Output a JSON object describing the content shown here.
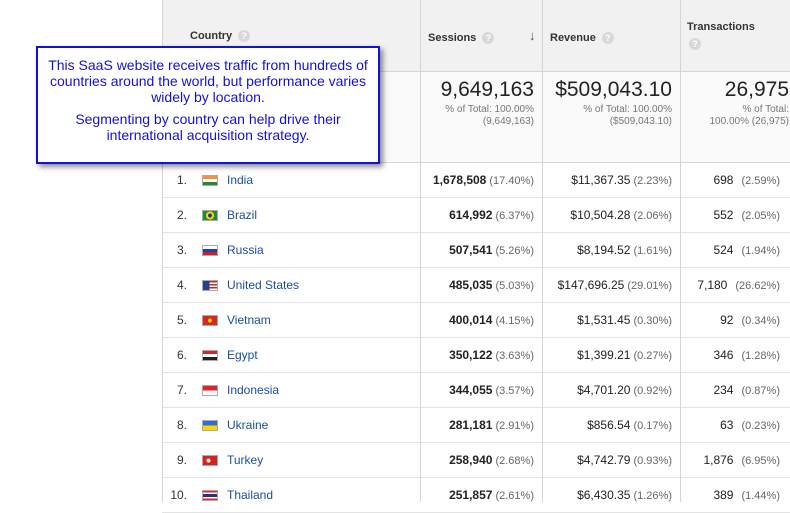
{
  "headers": {
    "country": "Country",
    "sessions": "Sessions",
    "revenue": "Revenue",
    "transactions": "Transactions",
    "help_glyph": "?",
    "sort_glyph": "↓"
  },
  "totals": {
    "sessions": "9,649,163",
    "sessions_pct": "% of Total: 100.00%",
    "sessions_abs": "(9,649,163)",
    "revenue": "$509,043.10",
    "revenue_pct": "% of Total: 100.00%",
    "revenue_abs": "($509,043.10)",
    "transactions": "26,975",
    "transactions_pct": "% of Total:",
    "transactions_abs": "100.00% (26,975)"
  },
  "callout": {
    "line1": "This SaaS website receives traffic from hundreds of countries around the world, but performance varies widely by location.",
    "line2": "Segmenting by country can help drive their international acquisition strategy."
  },
  "rows": [
    {
      "rank": "1.",
      "country": "India",
      "flag": "india",
      "sessions": "1,678,508",
      "sessions_pct": "(17.40%)",
      "revenue": "$11,367.35",
      "revenue_pct": "(2.23%)",
      "transactions": "698",
      "transactions_pct": "(2.59%)"
    },
    {
      "rank": "2.",
      "country": "Brazil",
      "flag": "brazil",
      "sessions": "614,992",
      "sessions_pct": "(6.37%)",
      "revenue": "$10,504.28",
      "revenue_pct": "(2.06%)",
      "transactions": "552",
      "transactions_pct": "(2.05%)"
    },
    {
      "rank": "3.",
      "country": "Russia",
      "flag": "russia",
      "sessions": "507,541",
      "sessions_pct": "(5.26%)",
      "revenue": "$8,194.52",
      "revenue_pct": "(1.61%)",
      "transactions": "524",
      "transactions_pct": "(1.94%)"
    },
    {
      "rank": "4.",
      "country": "United States",
      "flag": "usa",
      "sessions": "485,035",
      "sessions_pct": "(5.03%)",
      "revenue": "$147,696.25",
      "revenue_pct": "(29.01%)",
      "transactions": "7,180",
      "transactions_pct": "(26.62%)"
    },
    {
      "rank": "5.",
      "country": "Vietnam",
      "flag": "vietnam",
      "sessions": "400,014",
      "sessions_pct": "(4.15%)",
      "revenue": "$1,531.45",
      "revenue_pct": "(0.30%)",
      "transactions": "92",
      "transactions_pct": "(0.34%)"
    },
    {
      "rank": "6.",
      "country": "Egypt",
      "flag": "egypt",
      "sessions": "350,122",
      "sessions_pct": "(3.63%)",
      "revenue": "$1,399.21",
      "revenue_pct": "(0.27%)",
      "transactions": "346",
      "transactions_pct": "(1.28%)"
    },
    {
      "rank": "7.",
      "country": "Indonesia",
      "flag": "indonesia",
      "sessions": "344,055",
      "sessions_pct": "(3.57%)",
      "revenue": "$4,701.20",
      "revenue_pct": "(0.92%)",
      "transactions": "234",
      "transactions_pct": "(0.87%)"
    },
    {
      "rank": "8.",
      "country": "Ukraine",
      "flag": "ukraine",
      "sessions": "281,181",
      "sessions_pct": "(2.91%)",
      "revenue": "$856.54",
      "revenue_pct": "(0.17%)",
      "transactions": "63",
      "transactions_pct": "(0.23%)"
    },
    {
      "rank": "9.",
      "country": "Turkey",
      "flag": "turkey",
      "sessions": "258,940",
      "sessions_pct": "(2.68%)",
      "revenue": "$4,742.79",
      "revenue_pct": "(0.93%)",
      "transactions": "1,876",
      "transactions_pct": "(6.95%)"
    },
    {
      "rank": "10.",
      "country": "Thailand",
      "flag": "thailand",
      "sessions": "251,857",
      "sessions_pct": "(2.61%)",
      "revenue": "$6,430.35",
      "revenue_pct": "(1.26%)",
      "transactions": "389",
      "transactions_pct": "(1.44%)"
    }
  ]
}
